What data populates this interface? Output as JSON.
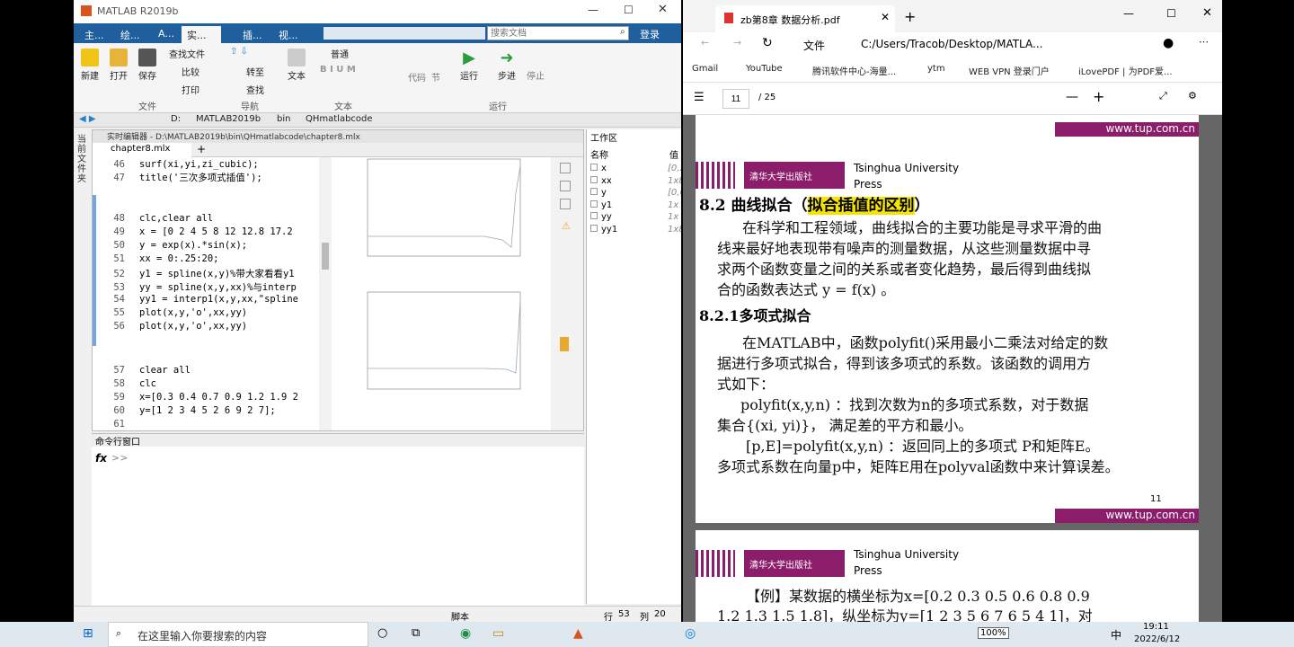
{
  "matlab": {
    "title": "MATLAB R2019b",
    "tabs": [
      "主...",
      "绘...",
      "A...",
      "实...",
      "插...",
      "视..."
    ],
    "search_placeholder": "搜索文档",
    "login": "登录",
    "ribbon": {
      "new": "新建",
      "open": "打开",
      "save": "保存",
      "find_files": "查找文件",
      "compare": "比较",
      "print": "打印",
      "goto": "转至",
      "find": "查找",
      "text": "文本",
      "normal": "普通",
      "code": "代码",
      "section": "节",
      "run": "运行",
      "step": "步进",
      "stop": "停止",
      "sec_file": "文件",
      "sec_nav": "导航",
      "sec_text": "文本",
      "sec_run": "运行"
    },
    "path": [
      "D:",
      "MATLAB2019b",
      "bin",
      "QHmatlabcode"
    ],
    "editor_title": "实时编辑器 - D:\\MATLAB2019b\\bin\\QHmatlabcode\\chapter8.mlx",
    "file_tab": "chapter8.mlx",
    "side_label": "当前文件夹",
    "code": [
      {
        "n": "46",
        "t": "surf(xi,yi,zi_cubic);"
      },
      {
        "n": "47",
        "t": "title('三次多项式插值');"
      },
      {
        "n": "48",
        "t": "clc,clear all"
      },
      {
        "n": "49",
        "t": "x = [0 2 4 5 8 12 12.8 17.2"
      },
      {
        "n": "50",
        "t": "y = exp(x).*sin(x);"
      },
      {
        "n": "51",
        "t": "xx = 0:.25:20;"
      },
      {
        "n": "52",
        "t": "y1 = spline(x,y)%带大家看看y1"
      },
      {
        "n": "53",
        "t": "yy = spline(x,y,xx)%与interp"
      },
      {
        "n": "54",
        "t": "yy1 = interp1(x,y,xx,\"spline"
      },
      {
        "n": "55",
        "t": "plot(x,y,'o',xx,yy)"
      },
      {
        "n": "56",
        "t": "plot(x,y,'o',xx,yy)"
      },
      {
        "n": "57",
        "t": "clear all"
      },
      {
        "n": "58",
        "t": "clc"
      },
      {
        "n": "59",
        "t": "x=[0.3 0.4 0.7 0.9 1.2 1.9 2"
      },
      {
        "n": "60",
        "t": "y=[1 2 3 4 5 2 6 9 2 7];"
      },
      {
        "n": "61",
        "t": ""
      }
    ],
    "workspace": {
      "title": "工作区",
      "col_name": "名称",
      "col_value": "值",
      "vars": [
        {
          "name": "x",
          "value": "[0,2"
        },
        {
          "name": "xx",
          "value": "1x8"
        },
        {
          "name": "y",
          "value": "[0,6"
        },
        {
          "name": "y1",
          "value": "1x"
        },
        {
          "name": "yy",
          "value": "1x"
        },
        {
          "name": "yy1",
          "value": "1x8"
        }
      ]
    },
    "cmd_title": "命令行窗口",
    "prompt": ">>",
    "fx": "fx",
    "status": {
      "mode": "脚本",
      "row_label": "行",
      "row": "53",
      "col_label": "列",
      "col": "20"
    }
  },
  "edge": {
    "tab_title": "zb第8章 数据分析.pdf",
    "url_label": "文件",
    "url": "C:/Users/Tracob/Desktop/MATLA...",
    "bookmarks": [
      "Gmail",
      "YouTube",
      "腾讯软件中心-海量...",
      "ytm",
      "WEB VPN 登录门户",
      "iLovePDF | 为PDF爱..."
    ],
    "page_num": "11",
    "page_total": "/ 25",
    "site": "www.tup.com.cn",
    "publisher": "Tsinghua University",
    "publisher2": "Press",
    "logo": "清华大学出版社",
    "heading_num": "8.2",
    "heading_a": "曲线拟合（",
    "heading_hl": "拟合插值的区别",
    "heading_b": "）",
    "para1": [
      "在科学和工程领域，曲线拟合的主要功能是寻求平滑的曲",
      "线来最好地表现带有噪声的测量数据，从这些测量数据中寻",
      "求两个函数变量之间的关系或者变化趋势，最后得到曲线拟",
      "合的函数表达式  y = f(x)    。"
    ],
    "sub": "8.2.1多项式拟合",
    "para2": [
      "在MATLAB中，函数polyfit()采用最小二乘法对给定的数",
      "据进行多项式拟合，得到该多项式的系数。该函数的调用方",
      "式如下：",
      "polyfit(x,y,n) ：找到次数为n的多项式系数，对于数据",
      "集合{(xi, yi)}， 满足差的平方和最小。",
      "[p,E]=polyfit(x,y,n) ：返回同上的多项式 P和矩阵E。",
      "多项式系数在向量p中，矩阵E用在polyval函数中来计算误差。"
    ],
    "page_footer": "11",
    "ex_line1": "【例】某数据的横坐标为x=[0.2 0.3 0.5 0.6 0.8 0.9",
    "ex_line2": "1.2 1.3 1.5 1.8]，纵坐标为y=[1 2 3 5 6 7 6 5 4 1]，对"
  },
  "taskbar": {
    "search": "在这里输入你要搜索的内容",
    "battery": "100%",
    "ime": "中",
    "time": "19:11",
    "date": "2022/6/12"
  }
}
